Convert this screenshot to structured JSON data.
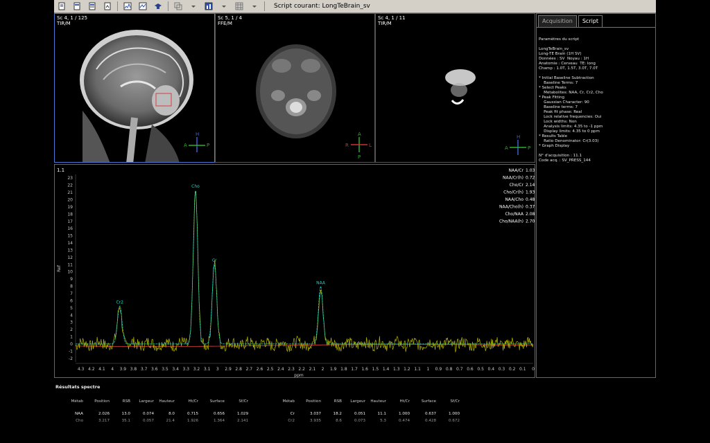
{
  "toolbar": {
    "title": "Script courant: LongTeBrain_sv",
    "icons": [
      "doc-icon",
      "doc-icon",
      "doc-icon",
      "doc-icon",
      "graph-icon",
      "graph-icon",
      "cap-icon",
      "layers-icon",
      "chart-icon",
      "grid-icon"
    ]
  },
  "viewports": [
    {
      "line1": "Sc 4, 1 / 125",
      "line2": "TIR/M",
      "ori": {
        "top": "H",
        "left": "A",
        "right": "P",
        "bottom": ""
      }
    },
    {
      "line1": "Sc 5, 1 / 4",
      "line2": "FFE/M",
      "ori": {
        "top": "A",
        "left": "R",
        "right": "L",
        "bottom": "P"
      }
    },
    {
      "line1": "Sc 4, 1 / 11",
      "line2": "TIR/M",
      "ori": {
        "top": "H",
        "left": "A",
        "right": "P",
        "bottom": ""
      }
    }
  ],
  "spectrum": {
    "scale_label": "1.1",
    "y_axis_label": "Ref",
    "x_axis_label": "ppm",
    "y_ticks": [
      23,
      22,
      21,
      20,
      19,
      18,
      17,
      16,
      15,
      14,
      13,
      12,
      11,
      10,
      9,
      8,
      7,
      6,
      5,
      4,
      3,
      2,
      1,
      0,
      -1,
      -2
    ],
    "x_ticks": [
      "4.3",
      "4.2",
      "4.1",
      "4",
      "3.9",
      "3.8",
      "3.7",
      "3.6",
      "3.5",
      "3.4",
      "3.3",
      "3.2",
      "3.1",
      "3",
      "2.9",
      "2.8",
      "2.7",
      "2.6",
      "2.5",
      "2.4",
      "2.3",
      "2.2",
      "2.1",
      "2",
      "1.9",
      "1.8",
      "1.7",
      "1.6",
      "1.5",
      "1.4",
      "1.3",
      "1.2",
      "1.1",
      "1",
      "0.9",
      "0.8",
      "0.7",
      "0.6",
      "0.5",
      "0.4",
      "0.3",
      "0.2",
      "0.1",
      "0"
    ],
    "peaks": [
      {
        "label": "Cr2",
        "ppm": 3.93,
        "height": 5.3
      },
      {
        "label": "Cho",
        "ppm": 3.21,
        "height": 21.4
      },
      {
        "label": "Cr",
        "ppm": 3.03,
        "height": 11.1
      },
      {
        "label": "NAA",
        "ppm": 2.02,
        "height": 8.0
      }
    ],
    "ratios": [
      {
        "name": "NAA/Cr",
        "value": "1.03"
      },
      {
        "name": "NAA/Cr(h)",
        "value": "0.72"
      },
      {
        "name": "Cho/Cr",
        "value": "2.14"
      },
      {
        "name": "Cho/Cr(h)",
        "value": "1.93"
      },
      {
        "name": "NAA/Cho",
        "value": "0.48"
      },
      {
        "name": "NAA/Cho(h)",
        "value": "0.37"
      },
      {
        "name": "Cho/NAA",
        "value": "2.08"
      },
      {
        "name": "Cho/NAA(h)",
        "value": "2.70"
      }
    ],
    "colors": {
      "fit": "#b8b800",
      "model": "#1fd6c0",
      "baseline": "#e04040",
      "ratio_text": "#ffffff"
    }
  },
  "chart_data": {
    "type": "line",
    "xlabel": "ppm",
    "ylabel": "Ref",
    "xlim": [
      4.35,
      0
    ],
    "ylim": [
      -2.5,
      23.5
    ],
    "series": [
      {
        "name": "Cr2",
        "x": [
          3.93
        ],
        "values": [
          5.3
        ]
      },
      {
        "name": "Cho",
        "x": [
          3.21
        ],
        "values": [
          21.4
        ]
      },
      {
        "name": "Cr",
        "x": [
          3.03
        ],
        "values": [
          11.1
        ]
      },
      {
        "name": "NAA",
        "x": [
          2.02
        ],
        "values": [
          8.0
        ]
      }
    ]
  },
  "panel": {
    "tabs": [
      {
        "label": "Acquisition",
        "active": false
      },
      {
        "label": "Script",
        "active": true
      }
    ],
    "script_text": "Paramètres du script\n\nLongTeBrain_sv\nLong-TE Brain (1H SV)\nDonnées : SV  Noyau : 1H\nAnatomie : Cerveau  TE: long\nChamp : 1.0T, 1.5T, 3.0T, 7.0T\n\n* Initial Baseline Subtraction\n    Baseline Terms: 7\n* Select Peaks\n    Metabolites: NAA, Cr, Cr2, Cho\n* Peak Fitting\n    Gaussian Character: 90\n    Baseline terms: 7\n    Peak fit phase: Real\n    Lock relative frequencies: Oui\n    Lock widths: Non\n    Analysis limits: 4.35 to -1 ppm\n    Display limits: 4.35 to 0 ppm\n* Results Table\n    Ratio Denominator: Cr(3.03)\n* Graph Display\n\nN° d'acquisition : 11.1\nCode acq. : SV_PRESS_144"
  },
  "results": {
    "title": "Résultats spectre",
    "headers": [
      "Métab",
      "Position",
      "RSB",
      "Largeur",
      "Hauteur",
      "Ht/Cr",
      "Surface",
      "Sf/Cr"
    ],
    "left_rows": [
      [
        "NAA",
        "2.026",
        "13.0",
        "0.074",
        "8.0",
        "0.715",
        "0.656",
        "1.029"
      ],
      [
        "Cho",
        "3.217",
        "35.1",
        "0.057",
        "21.4",
        "1.926",
        "1.364",
        "2.141"
      ]
    ],
    "right_rows": [
      [
        "Cr",
        "3.037",
        "18.2",
        "0.051",
        "11.1",
        "1.000",
        "0.637",
        "1.000"
      ],
      [
        "Cr2",
        "3.935",
        "8.6",
        "0.073",
        "5.3",
        "0.474",
        "0.428",
        "0.672"
      ]
    ]
  }
}
